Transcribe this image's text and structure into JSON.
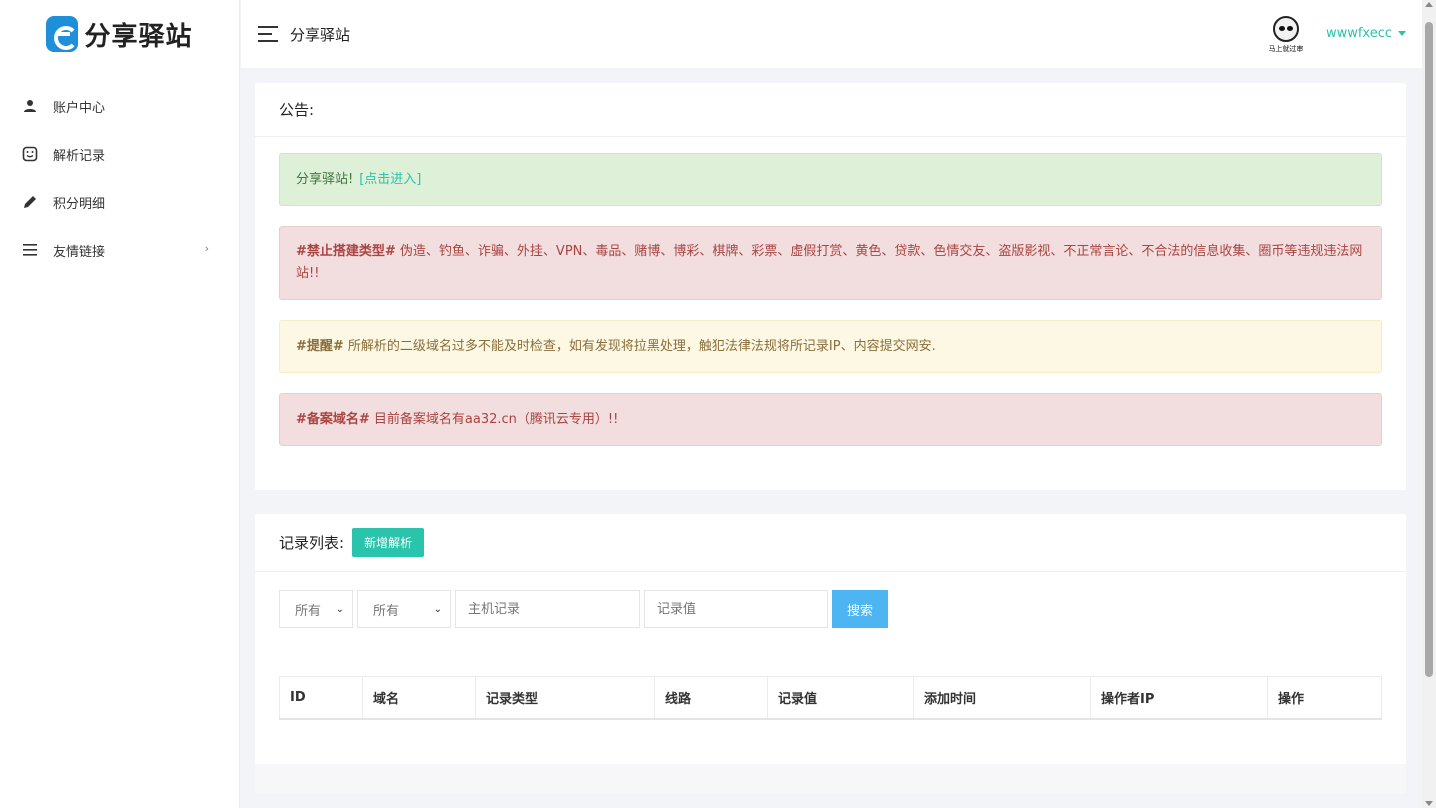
{
  "app": {
    "name": "分享驿站"
  },
  "header": {
    "title": "分享驿站",
    "username": "wwwfxecc",
    "avatar_caption": "马上就过审"
  },
  "sidebar": {
    "items": [
      {
        "label": "账户中心",
        "icon": "user-icon"
      },
      {
        "label": "解析记录",
        "icon": "record-icon"
      },
      {
        "label": "积分明细",
        "icon": "pencil-icon"
      },
      {
        "label": "友情链接",
        "icon": "menu-lines-icon",
        "chevron": "›"
      }
    ]
  },
  "notice": {
    "title": "公告:",
    "green": {
      "text": "分享驿站!",
      "link": "[点击进入]"
    },
    "red1": {
      "tag": "#禁止搭建类型#",
      "text": " 伪造、钓鱼、诈骗、外挂、VPN、毒品、赌博、博彩、棋牌、彩票、虚假打赏、黄色、贷款、色情交友、盗版影视、不正常言论、不合法的信息收集、圈币等违规违法网站!!"
    },
    "yellow": {
      "tag": "#提醒#",
      "text": " 所解析的二级域名过多不能及时检查，如有发现将拉黑处理，触犯法律法规将所记录IP、内容提交网安."
    },
    "red2": {
      "tag": "#备案域名#",
      "text": " 目前备案域名有aa32.cn（腾讯云专用）!!"
    }
  },
  "records": {
    "title": "记录列表:",
    "add_button": "新增解析",
    "filters": {
      "select1": "所有",
      "select2": "所有",
      "host_placeholder": "主机记录",
      "value_placeholder": "记录值",
      "search_button": "搜索"
    },
    "columns": [
      "ID",
      "域名",
      "记录类型",
      "线路",
      "记录值",
      "添加时间",
      "操作者IP",
      "操作"
    ]
  },
  "colors": {
    "accent": "#2ac3ab",
    "search": "#4db6f2"
  }
}
